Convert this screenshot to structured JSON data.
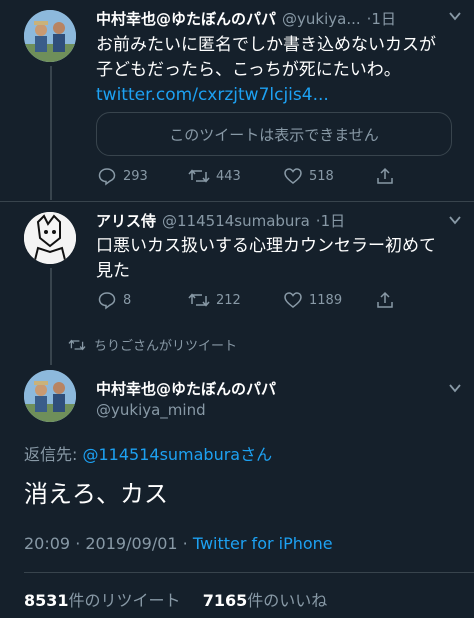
{
  "tweet1": {
    "name": "中村幸也@ゆたぼんのパパ",
    "handle": "@yukiya...",
    "time": "·1日",
    "text_line1": "お前みたいに匿名でしか書き込めないカスが",
    "text_line2": "子どもだったら、こっちが死にたいわ。",
    "link": "twitter.com/cxrzjtw7lcjis4...",
    "quote_unavailable": "このツイートは表示できません",
    "replies": "293",
    "retweets": "443",
    "likes": "518"
  },
  "tweet2": {
    "name": "アリス侍",
    "handle": "@114514sumabura",
    "time": "·1日",
    "text_line1": "口悪いカス扱いする心理カウンセラー初めて",
    "text_line2": "見た",
    "replies": "8",
    "retweets": "212",
    "likes": "1189"
  },
  "retweet_banner": "ちりごさんがリツイート",
  "main_tweet": {
    "name": "中村幸也@ゆたぼんのパパ",
    "handle": "@yukiya_mind",
    "reply_prefix": "返信先: ",
    "reply_to": "@114514sumaburaさん",
    "text": "消えろ、カス",
    "timestamp": "20:09 · 2019/09/01 · ",
    "source": "Twitter for iPhone",
    "retweet_count": "8531",
    "retweet_label": "件のリツイート",
    "like_count": "7165",
    "like_label": "件のいいね"
  },
  "colors": {
    "background": "#15202b",
    "secondary_text": "#8899a6",
    "link": "#1da1f2",
    "border": "#38444d"
  }
}
